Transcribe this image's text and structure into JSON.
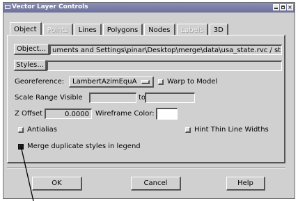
{
  "window": {
    "title": "Vector Layer Controls",
    "close_glyph": "×"
  },
  "tabs": [
    {
      "label": "Object",
      "active": true,
      "disabled": false
    },
    {
      "label": "Points",
      "active": false,
      "disabled": true
    },
    {
      "label": "Lines",
      "active": false,
      "disabled": false
    },
    {
      "label": "Polygons",
      "active": false,
      "disabled": false
    },
    {
      "label": "Nodes",
      "active": false,
      "disabled": false
    },
    {
      "label": "Labels",
      "active": false,
      "disabled": true
    },
    {
      "label": "3D",
      "active": false,
      "disabled": false
    }
  ],
  "object": {
    "object_button": "Object...",
    "object_path": "uments and Settings\\pinar\\Desktop\\merge\\data\\usa_state.rvc / states",
    "styles_button": "Styles...",
    "styles_value": ""
  },
  "georeference": {
    "label": "Georeference:",
    "value": "LambertAzimEquA",
    "warp_label": "Warp to Model",
    "warp_checked": false
  },
  "scale_range": {
    "label": "Scale Range Visible",
    "from": "",
    "to_label": "to",
    "to": ""
  },
  "zoffset": {
    "label": "Z Offset",
    "value": "0.0000",
    "wireframe_label": "Wireframe Color:"
  },
  "options": {
    "antialias_label": "Antialias",
    "antialias_checked": false,
    "hint_label": "Hint Thin Line Widths",
    "hint_checked": false,
    "merge_label": "Merge duplicate styles in legend",
    "merge_checked": true
  },
  "buttons": {
    "ok": "OK",
    "cancel": "Cancel",
    "help": "Help"
  },
  "colors": {
    "titlebar": "#6c7099",
    "dialog": "#d0d0d0",
    "wireframe": "#ffffff"
  }
}
